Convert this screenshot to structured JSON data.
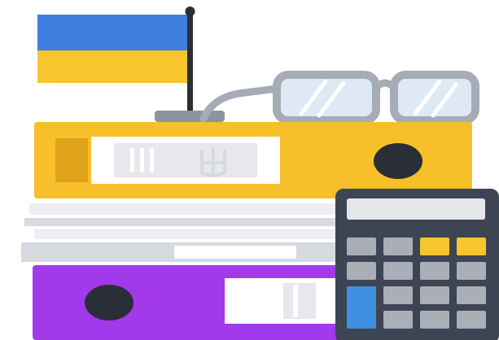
{
  "palette": {
    "flag_blue": "#3f7fe0",
    "flag_yellow": "#f7c62c",
    "binder_yellow": "#f7bf2a",
    "binder_yellow_dark": "#e0a21a",
    "binder_purple": "#a239ea",
    "paper": "#eceef2",
    "paper_shadow": "#d6d9df",
    "label_white": "#ffffff",
    "label_gray": "#e6e8ec",
    "hole_dark": "#2a2e36",
    "glasses_frame": "#a6acb6",
    "glasses_lens": "#dfe8f5",
    "pole": "#2a2e36",
    "pole_base": "#8d939d",
    "calc_body": "#3d4554",
    "calc_screen": "#e4e6ea",
    "key_gray": "#a9aeb7",
    "key_yellow": "#f7c62c",
    "key_blue": "#3f8fe0"
  },
  "icons": {
    "flag": "ukraine-flag-icon",
    "emblem": "trident-emblem-icon",
    "glasses": "eyeglasses-icon",
    "calculator": "calculator-icon"
  }
}
